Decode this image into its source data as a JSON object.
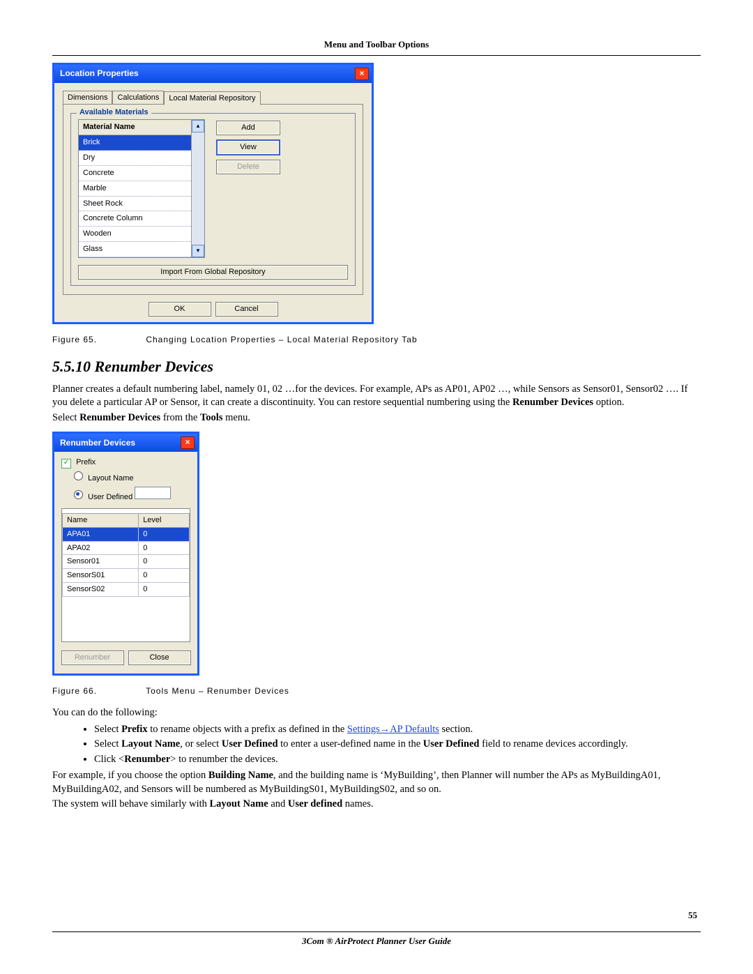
{
  "header": "Menu and Toolbar Options",
  "page_number": "55",
  "footer": "3Com ® AirProtect Planner User Guide",
  "dlg1": {
    "title": "Location Properties",
    "tabs": [
      "Dimensions",
      "Calculations",
      "Local Material Repository"
    ],
    "active_tab": 2,
    "group_label": "Available Materials",
    "col_header": "Material Name",
    "materials": [
      "Brick",
      "Dry",
      "Concrete",
      "Marble",
      "Sheet Rock",
      "Concrete Column",
      "Wooden",
      "Glass"
    ],
    "selected_material": 0,
    "side_buttons": {
      "add": "Add",
      "view": "View",
      "delete": "Delete"
    },
    "import_btn": "Import From Global Repository",
    "ok": "OK",
    "cancel": "Cancel"
  },
  "fig65": {
    "label": "Figure 65.",
    "text": "Changing Location Properties – Local Material Repository Tab"
  },
  "section_heading": "5.5.10  Renumber Devices",
  "para1": "Planner creates a default numbering label, namely 01, 02 …for the devices. For example, APs as AP01, AP02 …, while Sensors as Sensor01, Sensor02 …. If you delete a particular AP or Sensor, it can create a discontinuity. You can restore sequential numbering using the ",
  "para1_b": "Renumber Devices",
  "para1_c": " option.",
  "para2_a": "Select ",
  "para2_b": "Renumber Devices",
  "para2_c": " from the ",
  "para2_d": "Tools",
  "para2_e": " menu.",
  "dlg2": {
    "title": "Renumber Devices",
    "prefix_label": "Prefix",
    "opt_layout": "Layout Name",
    "opt_user": "User Defined",
    "cols": {
      "name": "Name",
      "level": "Level"
    },
    "rows": [
      {
        "n": "APA01",
        "l": "0",
        "sel": true
      },
      {
        "n": "APA02",
        "l": "0"
      },
      {
        "n": "Sensor01",
        "l": "0"
      },
      {
        "n": "SensorS01",
        "l": "0"
      },
      {
        "n": "SensorS02",
        "l": "0"
      }
    ],
    "renumber": "Renumber",
    "close": "Close"
  },
  "fig66": {
    "label": "Figure 66.",
    "text": "Tools Menu – Renumber Devices"
  },
  "after": "You can do the following:",
  "bul1_a": "Select ",
  "bul1_b": "Prefix",
  "bul1_c": " to rename objects with a prefix as defined in the ",
  "bul1_link": "Settings→AP Defaults",
  "bul1_d": " section.",
  "bul2_a": "Select ",
  "bul2_b": "Layout Name",
  "bul2_c": ", or select ",
  "bul2_d": "User Defined",
  "bul2_e": " to enter a user-defined name in the ",
  "bul2_f": "User Defined",
  "bul2_g": " field to rename devices accordingly.",
  "bul3_a": "Click <",
  "bul3_b": "Renumber",
  "bul3_c": "> to renumber the devices.",
  "tail1_a": "For example, if you choose the option ",
  "tail1_b": "Building Name",
  "tail1_c": ", and the building name is ‘MyBuilding’, then Planner will number the APs as MyBuildingA01, MyBuildingA02, and Sensors will be numbered as MyBuildingS01, MyBuildingS02, and so on.",
  "tail2_a": "The system will behave similarly with ",
  "tail2_b": "Layout Name",
  "tail2_c": " and ",
  "tail2_d": "User defined",
  "tail2_e": " names."
}
